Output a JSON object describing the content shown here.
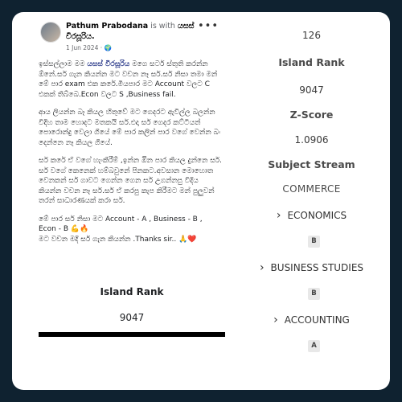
{
  "post": {
    "author": "Pathum Prabodana",
    "is_with": " is with ",
    "page": "යසස් වීරසූරිය.",
    "date": "1 Jun 2024 · ",
    "globe": "🌍",
    "more": "•••",
    "highlight": "යසස් වීරසූරිය",
    "p1_before": "ඉස්සල්ලාම මම ",
    "p1_after": " මගෙ සර්ට ස්තුති කරන්න ඕනේ.සර් ගැන කියන්න මට වචන නෑ සර්.සර් නිසා තමා මන් මේ පාර exam එක කරේ.මියපාර මට Account වලට C එකක් තිබ්බෙ.Econ වලට S ,Business fail.",
    "p2": "ආය ලියන්න බෑ කියල හිතුවේ මට ගෙදරට ඇවිල්ල බලන්න විදිහ තාම හොදට මතකයි සර්.එදා සර් ගෙදර කට්ටියත් පොරොන්දු වෙලා ගියේ මේ පාර කලින් පාර වගේ වෙන්න බං දෙන්නෙ නෑ කියල ගියේ.",
    "p3": "සර් කරේ ඒ වගේ හැංකිරීම් ,ඉන්න ඔින පාර කියල දුන්නෙ සර්. සර් වගේ කෙනෙක් හම්බවුනේ පිනකට.අවසාන මොහොත වෙනකන් සර් ගාවට ගෙන්න ගෙන සර් උගන්නපු විදිය කියන්න වචන නෑ සර්.සර් ඒ කරපු කැප කිරීමට මන් පුලුවන් තරන් සාධාරණයක් කරා සර්.",
    "p4a": "මේ පාර සර් නිසා මට Account - A , Business - B , Econ - B 💪🔥",
    "p4b": "මට වචන මදි සර් ගැන කියන්න .Thanks sir.. 🙏❤️"
  },
  "left_rank": {
    "label": "Island Rank",
    "value": "9047"
  },
  "results": {
    "top_value": "126",
    "island_rank_label": "Island Rank",
    "island_rank_value": "9047",
    "zscore_label": "Z-Score",
    "zscore_value": "1.0906",
    "stream_label": "Subject Stream",
    "stream_value": "COMMERCE",
    "subjects": [
      {
        "name": "ECONOMICS",
        "grade": "B"
      },
      {
        "name": "BUSINESS STUDIES",
        "grade": "B"
      },
      {
        "name": "ACCOUNTING",
        "grade": "A"
      }
    ],
    "chevron": "›"
  }
}
